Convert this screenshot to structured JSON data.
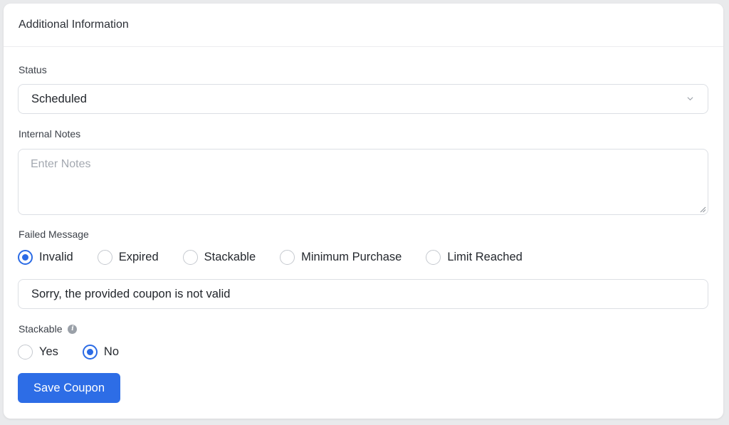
{
  "header": {
    "title": "Additional Information"
  },
  "status": {
    "label": "Status",
    "value": "Scheduled"
  },
  "notes": {
    "label": "Internal Notes",
    "placeholder": "Enter Notes",
    "value": ""
  },
  "failed_message": {
    "label": "Failed Message",
    "options": [
      "Invalid",
      "Expired",
      "Stackable",
      "Minimum Purchase",
      "Limit Reached"
    ],
    "selected": "Invalid",
    "message": "Sorry, the provided coupon is not valid"
  },
  "stackable": {
    "label": "Stackable",
    "options": [
      "Yes",
      "No"
    ],
    "selected": "No",
    "info_icon": "info-icon"
  },
  "actions": {
    "save_label": "Save Coupon"
  },
  "colors": {
    "accent": "#2d6de6",
    "border": "#dcdfe4",
    "placeholder": "#a3a8b0"
  }
}
